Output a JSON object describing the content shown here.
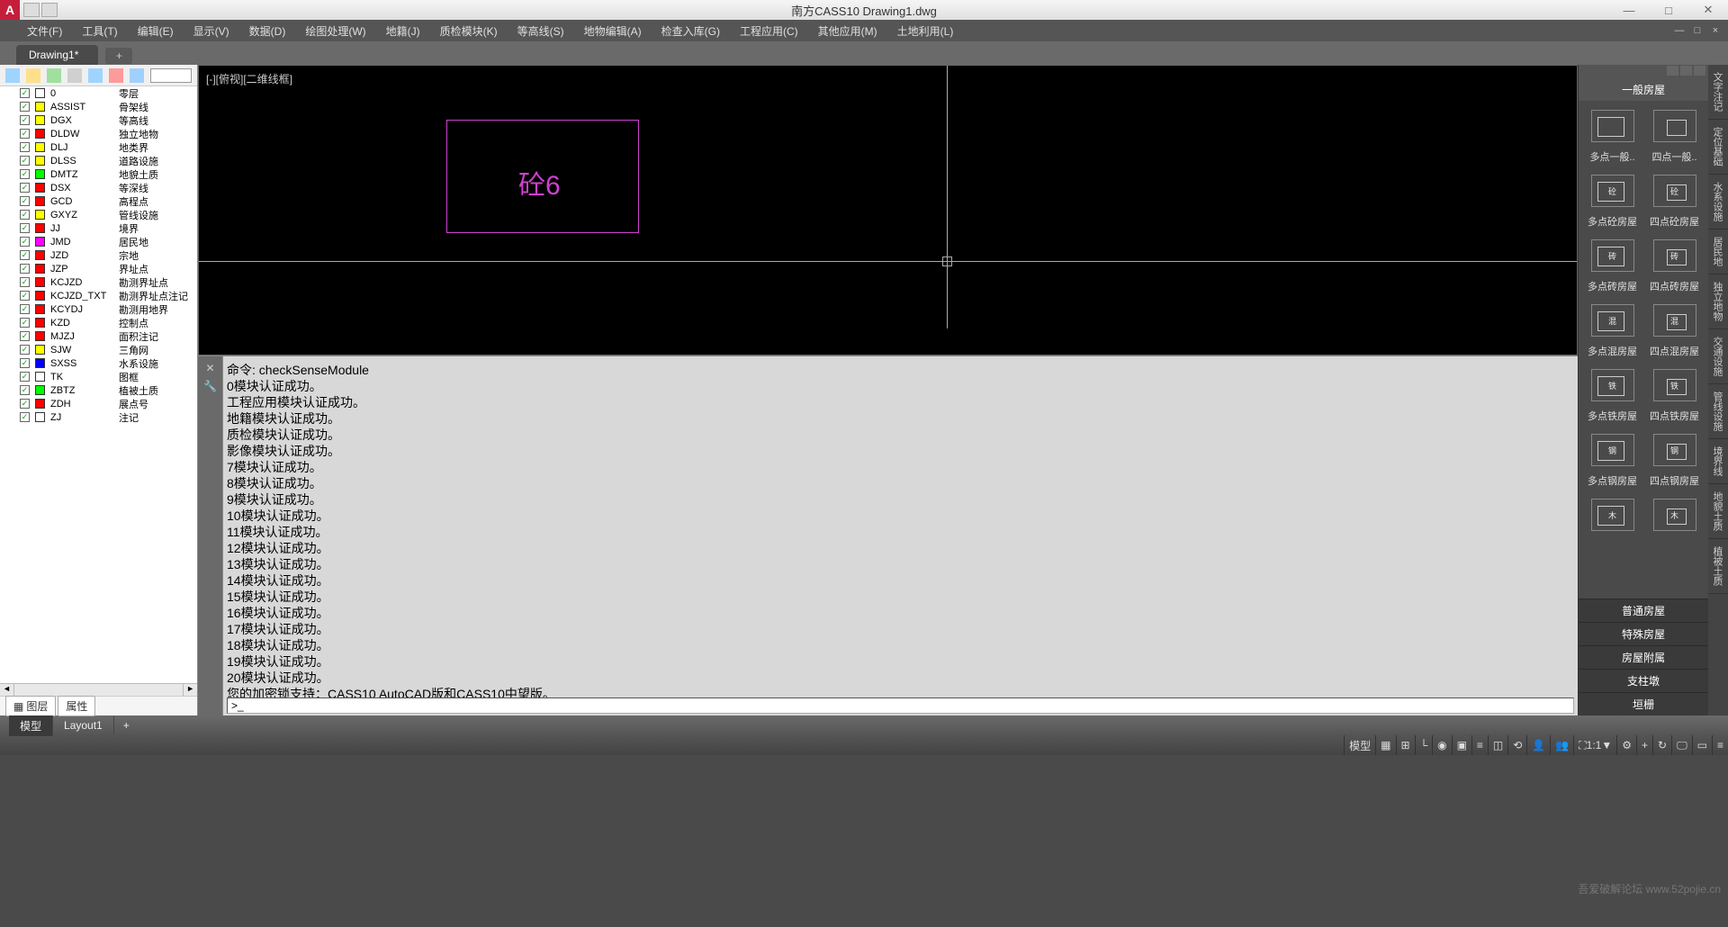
{
  "title": "南方CASS10   Drawing1.dwg",
  "menu": [
    "文件(F)",
    "工具(T)",
    "编辑(E)",
    "显示(V)",
    "数据(D)",
    "绘图处理(W)",
    "地籍(J)",
    "质检模块(K)",
    "等高线(S)",
    "地物编辑(A)",
    "检查入库(G)",
    "工程应用(C)",
    "其他应用(M)",
    "土地利用(L)"
  ],
  "tab": "Drawing1*",
  "vp_label": "[-][俯视][二维线框]",
  "vp_text": "砼6",
  "layers": [
    {
      "c": "0",
      "d": "零层",
      "sw": "#fff"
    },
    {
      "c": "ASSIST",
      "d": "骨架线",
      "sw": "#ffff00"
    },
    {
      "c": "DGX",
      "d": "等高线",
      "sw": "#ffff00"
    },
    {
      "c": "DLDW",
      "d": "独立地物",
      "sw": "#ff0000"
    },
    {
      "c": "DLJ",
      "d": "地类界",
      "sw": "#ffff00"
    },
    {
      "c": "DLSS",
      "d": "道路设施",
      "sw": "#ffff00"
    },
    {
      "c": "DMTZ",
      "d": "地貌土质",
      "sw": "#00ff00"
    },
    {
      "c": "DSX",
      "d": "等深线",
      "sw": "#ff0000"
    },
    {
      "c": "GCD",
      "d": "高程点",
      "sw": "#ff0000"
    },
    {
      "c": "GXYZ",
      "d": "管线设施",
      "sw": "#ffff00"
    },
    {
      "c": "JJ",
      "d": "境界",
      "sw": "#ff0000"
    },
    {
      "c": "JMD",
      "d": "居民地",
      "sw": "#ff00ff"
    },
    {
      "c": "JZD",
      "d": "宗地",
      "sw": "#ff0000"
    },
    {
      "c": "JZP",
      "d": "界址点",
      "sw": "#ff0000"
    },
    {
      "c": "KCJZD",
      "d": "勘测界址点",
      "sw": "#ff0000"
    },
    {
      "c": "KCJZD_TXT",
      "d": "勘测界址点注记",
      "sw": "#ff0000"
    },
    {
      "c": "KCYDJ",
      "d": "勘测用地界",
      "sw": "#ff0000"
    },
    {
      "c": "KZD",
      "d": "控制点",
      "sw": "#ff0000"
    },
    {
      "c": "MJZJ",
      "d": "面积注记",
      "sw": "#ff0000"
    },
    {
      "c": "SJW",
      "d": "三角网",
      "sw": "#ffff00"
    },
    {
      "c": "SXSS",
      "d": "水系设施",
      "sw": "#0000ff"
    },
    {
      "c": "TK",
      "d": "图框",
      "sw": "#fff"
    },
    {
      "c": "ZBTZ",
      "d": "植被土质",
      "sw": "#00ff00"
    },
    {
      "c": "ZDH",
      "d": "展点号",
      "sw": "#ff0000"
    },
    {
      "c": "ZJ",
      "d": "注记",
      "sw": "#fff"
    }
  ],
  "bottom_tabs": {
    "a": "图层",
    "b": "属性"
  },
  "cmd_lines": [
    "命令: checkSenseModule",
    "0模块认证成功。",
    "工程应用模块认证成功。",
    "地籍模块认证成功。",
    "质检模块认证成功。",
    "影像模块认证成功。",
    "7模块认证成功。",
    "8模块认证成功。",
    "9模块认证成功。",
    "10模块认证成功。",
    "11模块认证成功。",
    "12模块认证成功。",
    "13模块认证成功。",
    "14模块认证成功。",
    "15模块认证成功。",
    "16模块认证成功。",
    "17模块认证成功。",
    "18模块认证成功。",
    "19模块认证成功。",
    "20模块认证成功。",
    "您的加密锁支持：CASS10 AutoCAD版和CASS10中望版。"
  ],
  "cmd_prompt": ">_",
  "rp_title": "一般房屋",
  "palette": [
    {
      "a": "多点一般..",
      "b": "四点一般..",
      "ia": "",
      "ib": ""
    },
    {
      "a": "多点砼房屋",
      "b": "四点砼房屋",
      "ia": "砼",
      "ib": "砼"
    },
    {
      "a": "多点砖房屋",
      "b": "四点砖房屋",
      "ia": "砖",
      "ib": "砖"
    },
    {
      "a": "多点混房屋",
      "b": "四点混房屋",
      "ia": "混",
      "ib": "混"
    },
    {
      "a": "多点铁房屋",
      "b": "四点铁房屋",
      "ia": "铁",
      "ib": "铁"
    },
    {
      "a": "多点钢房屋",
      "b": "四点钢房屋",
      "ia": "钢",
      "ib": "钢"
    },
    {
      "a": "",
      "b": "",
      "ia": "木",
      "ib": "木"
    }
  ],
  "rp_cats": [
    "普通房屋",
    "特殊房屋",
    "房屋附属",
    "支柱墩",
    "垣栅"
  ],
  "far_right": [
    "文字注记",
    "定位基础",
    "水系设施",
    "居民地",
    "独立地物",
    "交通设施",
    "管线设施",
    "境界线",
    "地貌土质",
    "植被土质"
  ],
  "footer_tabs": {
    "a": "模型",
    "b": "Layout1"
  },
  "sb_model": "模型",
  "sb_scale": "1:1",
  "watermark": "吾爱破解论坛\nwww.52pojie.cn"
}
